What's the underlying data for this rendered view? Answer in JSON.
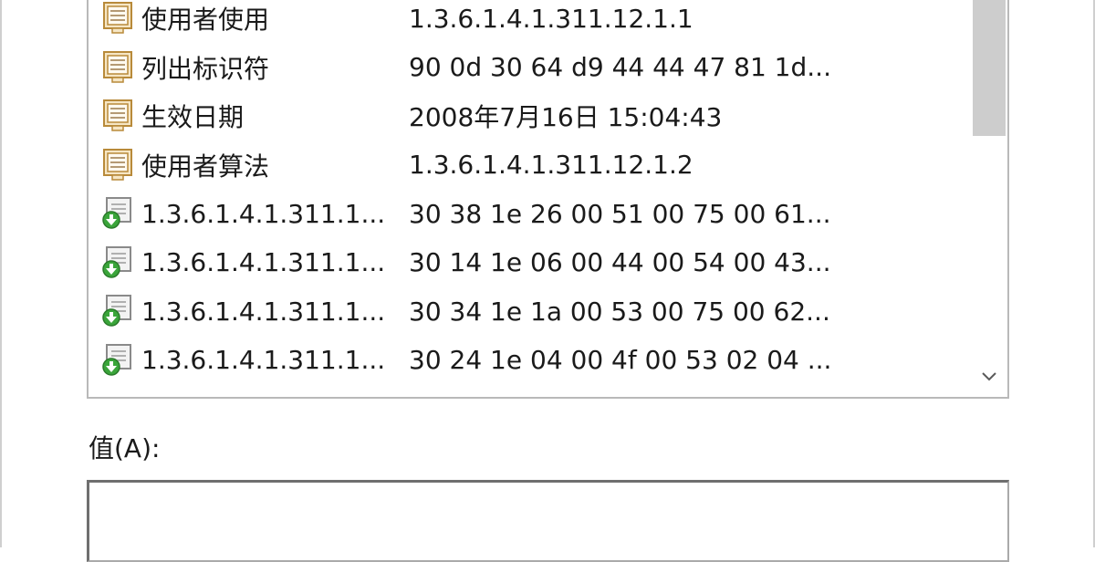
{
  "details_list": {
    "rows": [
      {
        "field": "使用者使用",
        "value": "1.3.6.1.4.1.311.12.1.1",
        "icon": "property-icon"
      },
      {
        "field": "列出标识符",
        "value": "90 0d 30 64 d9 44 44 47 81 1d...",
        "icon": "property-icon"
      },
      {
        "field": "生效日期",
        "value": "2008年7月16日 15:04:43",
        "icon": "property-icon"
      },
      {
        "field": "使用者算法",
        "value": "1.3.6.1.4.1.311.12.1.2",
        "icon": "property-icon"
      },
      {
        "field": "1.3.6.1.4.1.311.1...",
        "value": "30 38 1e 26 00 51 00 75 00 61...",
        "icon": "extension-icon"
      },
      {
        "field": "1.3.6.1.4.1.311.1...",
        "value": "30 14 1e 06 00 44 00 54 00 43...",
        "icon": "extension-icon"
      },
      {
        "field": "1.3.6.1.4.1.311.1...",
        "value": "30 34 1e 1a 00 53 00 75 00 62...",
        "icon": "extension-icon"
      },
      {
        "field": "1.3.6.1.4.1.311.1...",
        "value": "30 24 1e 04 00 4f 00 53 02 04 ...",
        "icon": "extension-icon"
      }
    ],
    "scroll_down_icon": "chevron-down-icon"
  },
  "value_section": {
    "label": "值(A):",
    "content": ""
  },
  "colors": {
    "property_icon_fill": "#f6e6c4",
    "property_icon_border": "#b88a3a",
    "extension_icon_arrow": "#3aa53a",
    "scroll_thumb": "#cdcdcd",
    "list_border": "#b9b9b9"
  }
}
